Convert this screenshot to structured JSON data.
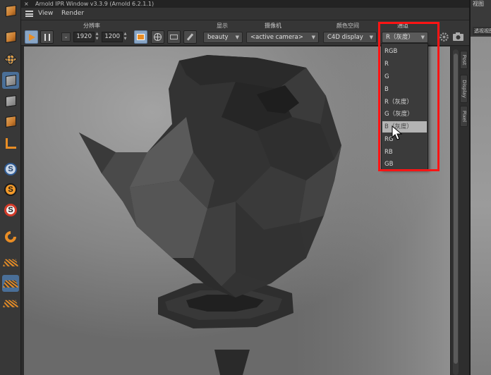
{
  "window": {
    "title": "Arnold IPR Window v3.3.9 (Arnold 6.2.1.1)",
    "close_glyph": "×"
  },
  "menu": {
    "items": [
      "View",
      "Render"
    ]
  },
  "toolbar": {
    "resolution_label": "分辨率",
    "width": "1920",
    "height": "1200",
    "display_label": "显示",
    "display_value": "beauty",
    "camera_label": "摄像机",
    "camera_value": "<active camera>",
    "colorspace_label": "颜色空间",
    "colorspace_value": "C4D display",
    "channel_label": "通道",
    "channel_value": "R（灰度）"
  },
  "channel_menu": {
    "options": [
      "RGB",
      "R",
      "G",
      "B",
      "R（灰度）",
      "G（灰度）",
      "B（灰度）",
      "RG",
      "RB",
      "GB"
    ],
    "hovered_index": 6
  },
  "side_tabs": [
    "Post",
    "Display",
    "Pixel"
  ],
  "right_panel": {
    "title": "视图",
    "subtitle": "透视视图"
  },
  "colors": {
    "highlight": "#ff1414",
    "accent_orange": "#e88d25",
    "selection_blue": "#4a6f98"
  },
  "icons": [
    "play-icon",
    "pause-icon",
    "lock-icon",
    "cube-icon",
    "checker-icon",
    "angle-icon",
    "spline-s-icon",
    "magnet-icon",
    "grid-icon",
    "camera-icon",
    "render-region-icon",
    "globe-icon",
    "crop-icon",
    "brush-icon"
  ]
}
